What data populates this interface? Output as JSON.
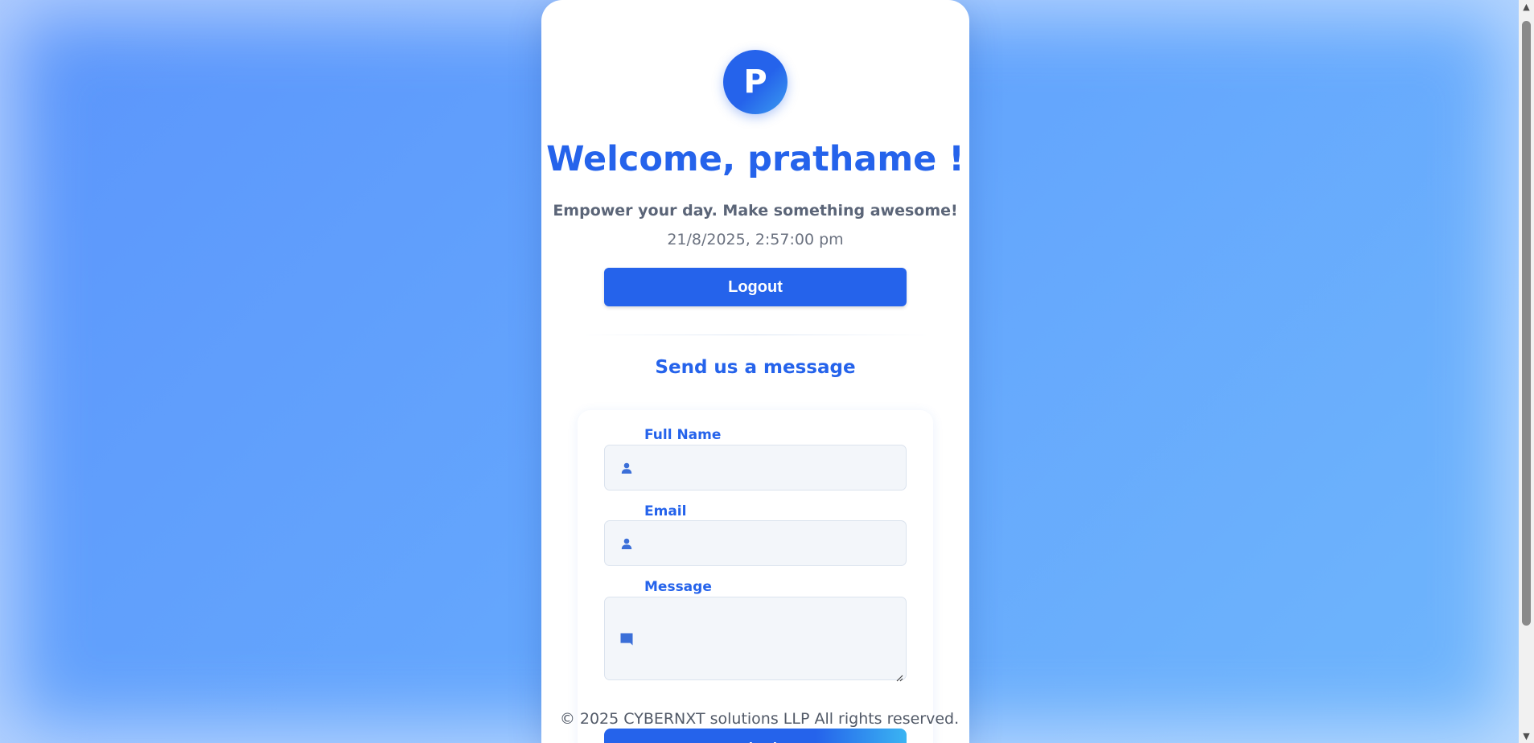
{
  "header": {
    "avatar_initial": "P",
    "welcome": "Welcome, prathame !",
    "tagline": "Empower your day. Make something awesome!",
    "datetime": "21/8/2025, 2:57:00 pm",
    "logout_label": "Logout"
  },
  "contact": {
    "title": "Send us a message",
    "fields": {
      "full_name": {
        "label": "Full Name",
        "value": "",
        "icon": "user-icon"
      },
      "email": {
        "label": "Email",
        "value": "",
        "icon": "user-icon"
      },
      "message": {
        "label": "Message",
        "value": "",
        "icon": "message-icon"
      }
    },
    "submit_label": "Submit"
  },
  "footer": {
    "copyright": "© 2025 CYBERNXT solutions LLP All rights reserved."
  },
  "colors": {
    "accent": "#2563eb",
    "background_start": "#5b95fb",
    "background_end": "#6fb6fc",
    "field_bg": "#f3f6fa"
  }
}
